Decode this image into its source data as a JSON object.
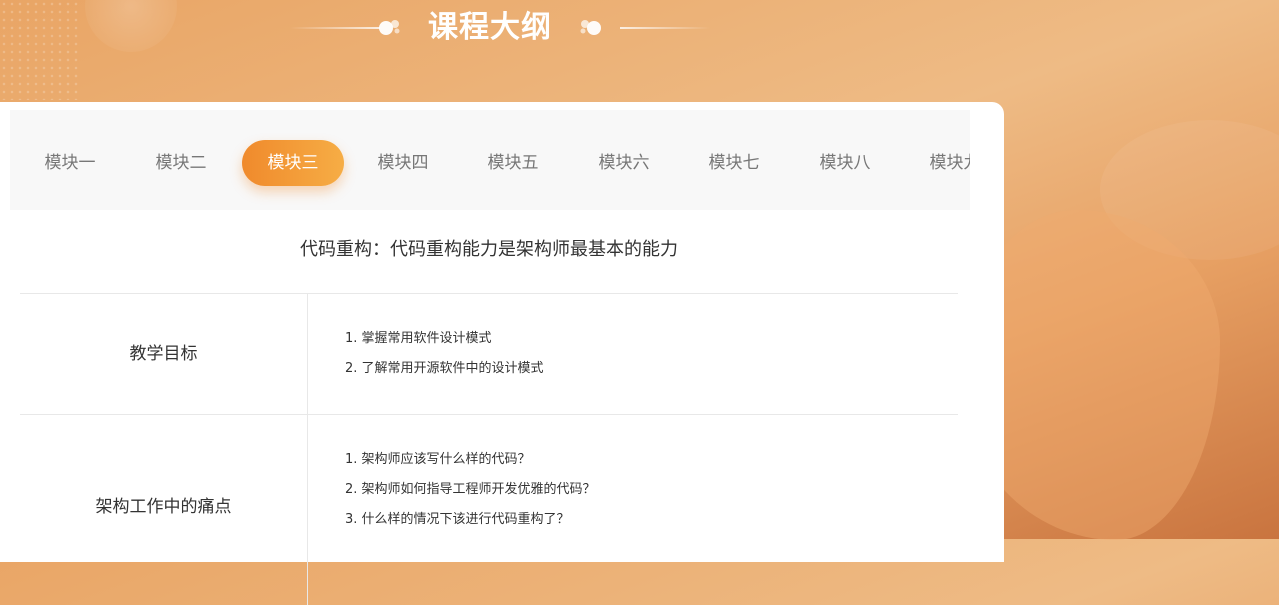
{
  "header": {
    "title": "课程大纲"
  },
  "tabs": [
    {
      "label": "模块一",
      "active": false
    },
    {
      "label": "模块二",
      "active": false
    },
    {
      "label": "模块三",
      "active": true
    },
    {
      "label": "模块四",
      "active": false
    },
    {
      "label": "模块五",
      "active": false
    },
    {
      "label": "模块六",
      "active": false
    },
    {
      "label": "模块七",
      "active": false
    },
    {
      "label": "模块八",
      "active": false
    },
    {
      "label": "模块九",
      "active": false
    }
  ],
  "module": {
    "title": "代码重构：代码重构能力是架构师最基本的能力"
  },
  "rows": [
    {
      "label": "教学目标",
      "items": [
        "1. 掌握常用软件设计模式",
        "2. 了解常用开源软件中的设计模式"
      ]
    },
    {
      "label": "架构工作中的痛点",
      "items": [
        "1. 架构师应该写什么样的代码？",
        "2. 架构师如何指导工程师开发优雅的代码？",
        "3. 什么样的情况下该进行代码重构了？"
      ]
    }
  ],
  "colors": {
    "accent_start": "#f08a2c",
    "accent_end": "#f6ad45",
    "background": "#eebb85"
  }
}
